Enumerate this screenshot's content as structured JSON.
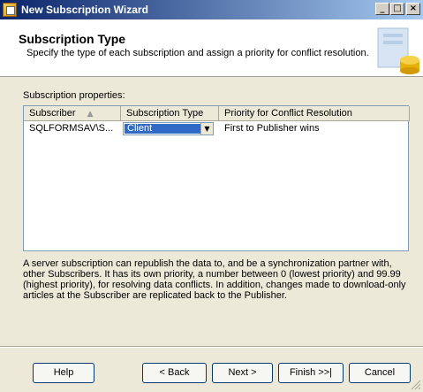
{
  "window": {
    "title": "New Subscription Wizard"
  },
  "header": {
    "title": "Subscription Type",
    "subtitle": "Specify the type of each subscription and assign a priority for conflict resolution."
  },
  "properties_label": "Subscription properties:",
  "table": {
    "columns": [
      "Subscriber",
      "Subscription Type",
      "Priority for Conflict Resolution"
    ],
    "rows": [
      {
        "subscriber": "SQLFORMSAV\\S...",
        "type": "Client",
        "priority": "First to Publisher wins"
      }
    ]
  },
  "description": "A server subscription can republish the data to, and be a synchronization partner with, other Subscribers. It has its own priority, a number between 0 (lowest priority) and 99.99 (highest priority), for resolving data conflicts. In addition, changes made to download-only articles at the Subscriber are replicated back to the Publisher.",
  "buttons": {
    "help": "Help",
    "back": "< Back",
    "next": "Next >",
    "finish": "Finish >>|",
    "cancel": "Cancel"
  },
  "titlebar_buttons": {
    "minimize": "_",
    "maximize": "□",
    "close": "×"
  },
  "icons": [
    "wizard-app-icon",
    "sort-ascending-icon",
    "dropdown-arrow-icon",
    "header-database-icon",
    "resize-grip-icon"
  ]
}
